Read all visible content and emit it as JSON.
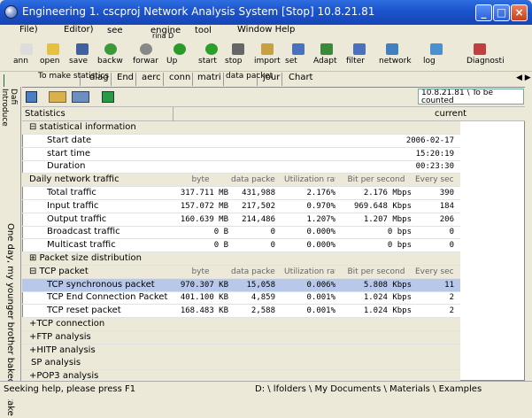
{
  "window": {
    "title": "Engineering 1. cscproj Network Analysis System [Stop] 10.8.21.81",
    "minimize": "_",
    "maximize": "□",
    "close": "×"
  },
  "menu": [
    "File)",
    "Editor)",
    "see",
    "engine",
    "tool",
    "Window Help"
  ],
  "menu_extra": "rina D",
  "toolbar": [
    {
      "label": "ann",
      "icon": "new-icon"
    },
    {
      "label": "open",
      "icon": "open-folder-icon"
    },
    {
      "label": "save",
      "icon": "save-icon"
    },
    {
      "label": "backw",
      "icon": "back-arrow-icon"
    },
    {
      "label": "forwar",
      "icon": "forward-arrow-icon"
    },
    {
      "label": "Up",
      "icon": "up-arrow-icon"
    },
    {
      "label": "start",
      "icon": "start-icon"
    },
    {
      "label": "stop",
      "icon": "stop-icon"
    },
    {
      "label": "import",
      "icon": "import-icon"
    },
    {
      "label": "set",
      "icon": "settings-icon"
    },
    {
      "label": "Adapt",
      "icon": "adapter-icon"
    },
    {
      "label": "filter",
      "icon": "filter-icon"
    },
    {
      "label": "network",
      "icon": "network-icon"
    },
    {
      "label": "log",
      "icon": "log-icon"
    },
    {
      "label": "Diagnosti",
      "icon": "diagnostics-icon"
    }
  ],
  "tabs": [
    "To make statistics",
    "diag",
    "End",
    "aerc",
    "conn",
    "matri",
    "data packet",
    "jour",
    "Chart"
  ],
  "subtool_path": "10.8.21.81 \\ To be counted",
  "left_label": "Dafi Introduce",
  "vertical_text": "One day, my younger brother baked a cake",
  "header": {
    "name": "Statistics",
    "current": "current"
  },
  "col_headers": {
    "byte": "byte",
    "packets": "data packet",
    "util": "Utilization rate",
    "bits": "Bit per second",
    "every": "Every second"
  },
  "rows": [
    {
      "type": "section",
      "label": "⊟ statistical information"
    },
    {
      "type": "info",
      "label": "Start date",
      "value": "2006-02-17"
    },
    {
      "type": "info",
      "label": "start time",
      "value": "15:20:19"
    },
    {
      "type": "info",
      "label": "Duration",
      "value": "00:23:30"
    },
    {
      "type": "colhead",
      "label": "Daily network traffic"
    },
    {
      "type": "data",
      "label": "Total traffic",
      "byte": "317.711 MB",
      "packets": "431,988",
      "util": "2.176%",
      "bits": "2.176 Mbps",
      "every": "390"
    },
    {
      "type": "data",
      "label": "Input traffic",
      "byte": "157.072 MB",
      "packets": "217,502",
      "util": "0.970%",
      "bits": "969.648 Kbps",
      "every": "184"
    },
    {
      "type": "data",
      "label": "Output traffic",
      "byte": "160.639 MB",
      "packets": "214,486",
      "util": "1.207%",
      "bits": "1.207 Mbps",
      "every": "206"
    },
    {
      "type": "data",
      "label": "Broadcast traffic",
      "byte": "0 B",
      "packets": "0",
      "util": "0.000%",
      "bits": "0 bps",
      "every": "0"
    },
    {
      "type": "data",
      "label": "Multicast traffic",
      "byte": "0 B",
      "packets": "0",
      "util": "0.000%",
      "bits": "0 bps",
      "every": "0"
    },
    {
      "type": "section",
      "label": "⊞ Packet size distribution"
    },
    {
      "type": "colhead",
      "label": "⊟ TCP packet"
    },
    {
      "type": "data",
      "sel": true,
      "label": "TCP synchronous packet",
      "byte": "970.307 KB",
      "packets": "15,058",
      "util": "0.006%",
      "bits": "5.808 Kbps",
      "every": "11"
    },
    {
      "type": "data",
      "label": "TCP End Connection Packet",
      "byte": "401.100 KB",
      "packets": "4,859",
      "util": "0.001%",
      "bits": "1.024 Kbps",
      "every": "2"
    },
    {
      "type": "data",
      "label": "TCP reset packet",
      "byte": "168.483 KB",
      "packets": "2,588",
      "util": "0.001%",
      "bits": "1.024 Kbps",
      "every": "2"
    },
    {
      "type": "section",
      "label": "+TCP connection"
    },
    {
      "type": "section",
      "label": "+FTP analysis"
    },
    {
      "type": "section",
      "label": "+HITP analysis"
    },
    {
      "type": "section",
      "label": "SP analysis"
    },
    {
      "type": "section",
      "label": "+POP3 analysis"
    }
  ],
  "status": {
    "help": "Seeking help, please press F1",
    "path": "D: \\ lfolders \\ My Documents \\ Materials \\ Examples"
  }
}
